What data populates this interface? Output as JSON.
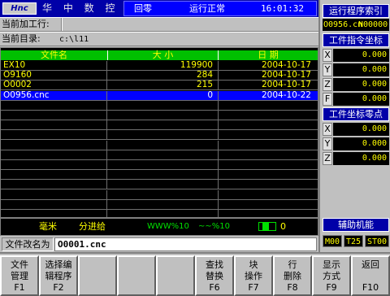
{
  "header": {
    "logo": "Hnc",
    "maker": "华 中 数 控",
    "mode": "回零",
    "run_status": "运行正常",
    "clock": "16:01:32"
  },
  "info": {
    "current_label": "当前加工行:",
    "current_value": "",
    "dir_label": "当前目录:",
    "dir_value": "c:\\l11"
  },
  "table": {
    "headers": {
      "name": "文件名",
      "size": "大 小",
      "date": "日 期"
    },
    "rows": [
      {
        "name": "EX10",
        "size": "119900",
        "date": "2004-10-17"
      },
      {
        "name": "O9160",
        "size": "284",
        "date": "2004-10-17"
      },
      {
        "name": "O0002",
        "size": "215",
        "date": "2004-10-17"
      },
      {
        "name": "O0956.cnc",
        "size": "0",
        "date": "2004-10-22"
      }
    ],
    "selected_index": 3
  },
  "status": {
    "unit": "毫米",
    "feed_mode": "分进给",
    "feed_override": "WWW%10",
    "spindle_override": "~~%10",
    "rapid_value": "0"
  },
  "rename": {
    "label": "文件改名为",
    "value": "O0001.cnc"
  },
  "right_panel": {
    "prog_header": "运行程序索引",
    "prog_name": "O0956.cn",
    "prog_n": "N00000",
    "cmd_header": "工件指令坐标",
    "cmd_axes": [
      {
        "axis": "X",
        "value": "0.000"
      },
      {
        "axis": "Y",
        "value": "0.000"
      },
      {
        "axis": "Z",
        "value": "0.000"
      },
      {
        "axis": "F",
        "value": "0.000"
      }
    ],
    "zero_header": "工件坐标零点",
    "zero_axes": [
      {
        "axis": "X",
        "value": "0.000"
      },
      {
        "axis": "Y",
        "value": "0.000"
      },
      {
        "axis": "Z",
        "value": "0.000"
      }
    ],
    "aux_header": "辅助机能",
    "codes": {
      "m": "M00",
      "t": "T25",
      "st": "ST00"
    }
  },
  "fkeys": [
    {
      "l1": "文件",
      "l2": "管理",
      "key": "F1"
    },
    {
      "l1": "选择编",
      "l2": "辑程序",
      "key": "F2"
    },
    {
      "l1": "",
      "l2": "",
      "key": ""
    },
    {
      "l1": "",
      "l2": "",
      "key": ""
    },
    {
      "l1": "",
      "l2": "",
      "key": ""
    },
    {
      "l1": "查找",
      "l2": "替换",
      "key": "F6"
    },
    {
      "l1": "块",
      "l2": "操作",
      "key": "F7"
    },
    {
      "l1": "行",
      "l2": "删除",
      "key": "F8"
    },
    {
      "l1": "显示",
      "l2": "方式",
      "key": "F9"
    },
    {
      "l1": "返回",
      "l2": "",
      "key": "F10"
    }
  ]
}
